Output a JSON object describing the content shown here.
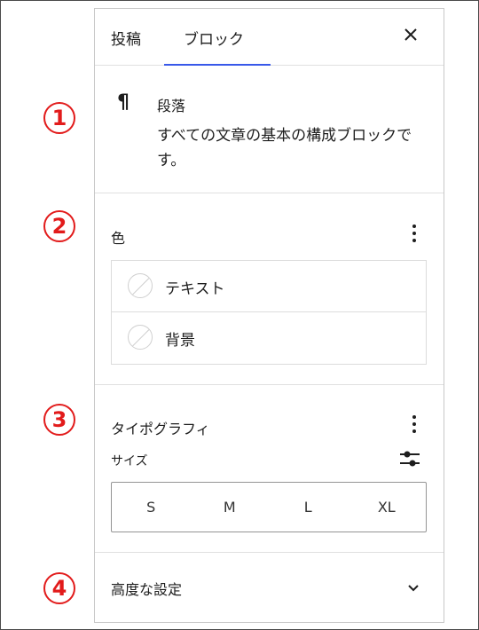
{
  "tabs": {
    "post": "投稿",
    "block": "ブロック"
  },
  "block": {
    "icon": "paragraph-icon",
    "glyph": "¶",
    "title": "段落",
    "description": "すべての文章の基本の構成ブロックです。"
  },
  "color": {
    "title": "色",
    "items": [
      {
        "label": "テキスト"
      },
      {
        "label": "背景"
      }
    ]
  },
  "typography": {
    "title": "タイポグラフィ",
    "size_label": "サイズ",
    "sizes": [
      "S",
      "M",
      "L",
      "XL"
    ]
  },
  "advanced": {
    "label": "高度な設定"
  },
  "callouts": [
    "1",
    "2",
    "3",
    "4"
  ],
  "colors": {
    "accent": "#3858e9",
    "callout": "#e21b1b"
  }
}
